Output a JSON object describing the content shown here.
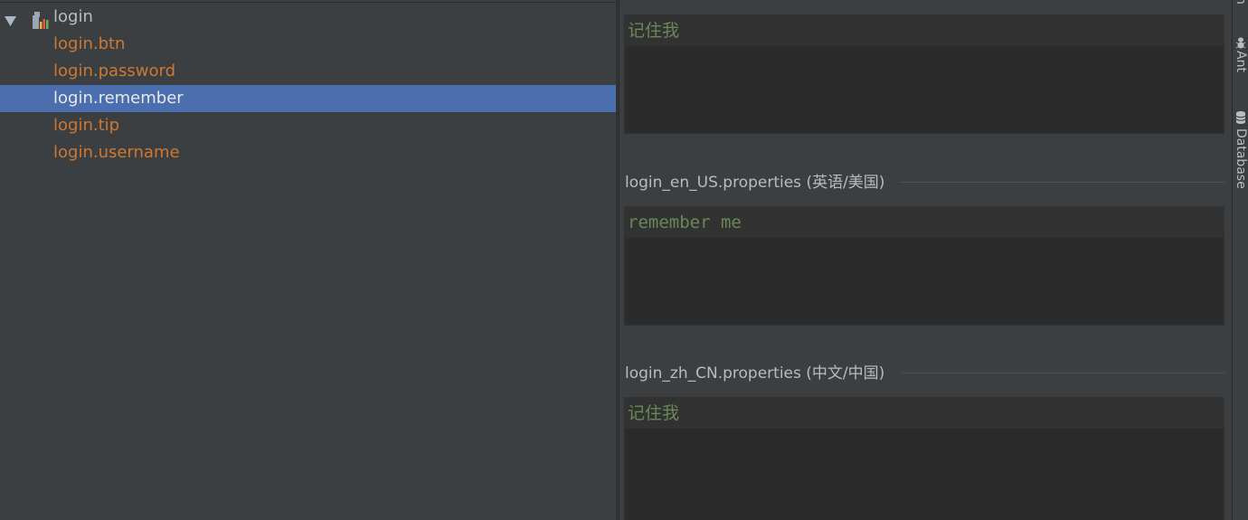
{
  "tree": {
    "root_label": "login",
    "keys": [
      {
        "label": "login.btn",
        "selected": false
      },
      {
        "label": "login.password",
        "selected": false
      },
      {
        "label": "login.remember",
        "selected": true
      },
      {
        "label": "login.tip",
        "selected": false
      },
      {
        "label": "login.username",
        "selected": false
      }
    ]
  },
  "editor": {
    "sections": [
      {
        "title": "",
        "value": "记住我"
      },
      {
        "title": "login_en_US.properties (英语/美国)",
        "value": "remember me"
      },
      {
        "title": "login_zh_CN.properties (中文/中国)",
        "value": "记住我"
      }
    ]
  },
  "tool_strip": {
    "items": [
      {
        "label": "Ant",
        "icon": "ant-icon"
      },
      {
        "label": "Database",
        "icon": "database-icon"
      }
    ]
  },
  "colors": {
    "key_text": "#cc7832",
    "value_text": "#6a8759",
    "selection": "#4b6eaf"
  }
}
